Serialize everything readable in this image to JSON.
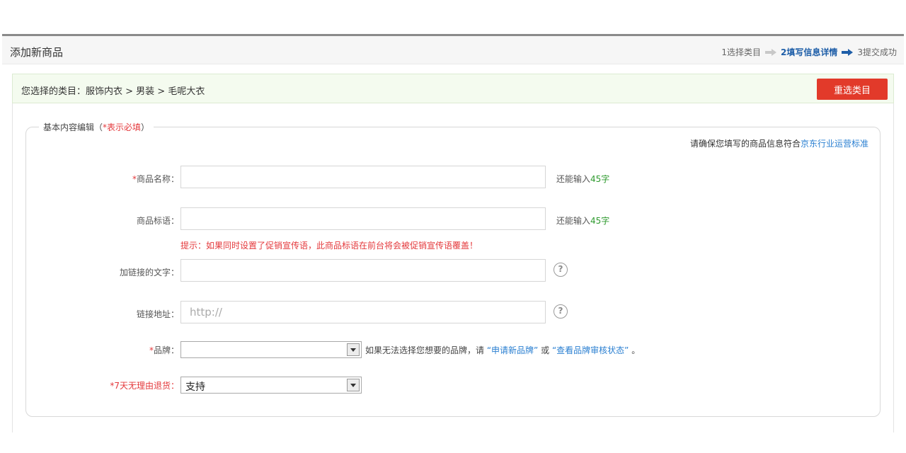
{
  "header": {
    "title": "添加新商品",
    "steps": [
      "1选择类目",
      "2填写信息详情",
      "3提交成功"
    ]
  },
  "category": {
    "label": "您选择的类目：",
    "path": "服饰内衣 > 男装 > 毛呢大衣",
    "reselect_button": "重选类目"
  },
  "section": {
    "legend_prefix": "基本内容编辑（",
    "legend_required": "*表示必填",
    "legend_suffix": "）",
    "notice_text": "请确保您填写的商品信息符合",
    "notice_link": "京东行业运营标准"
  },
  "form": {
    "product_name": {
      "star": "*",
      "label": "商品名称：",
      "value": "",
      "counter_prefix": "还能输入",
      "counter_num": "45字"
    },
    "product_slogan": {
      "label": "商品标语：",
      "value": "",
      "counter_prefix": "还能输入",
      "counter_num": "45字"
    },
    "slogan_hint": "提示：如果同时设置了促销宣传语，此商品标语在前台将会被促销宣传语覆盖！",
    "link_text": {
      "label": "加链接的文字：",
      "value": ""
    },
    "link_url": {
      "label": "链接地址：",
      "placeholder": "http://"
    },
    "brand": {
      "star": "*",
      "label": "品牌：",
      "value": "",
      "note_prefix": "如果无法选择您想要的品牌，请",
      "apply_link": "“申请新品牌”",
      "or": "或",
      "status_link": "“查看品牌审核状态”",
      "note_suffix": "。"
    },
    "return_policy": {
      "label": "*7天无理由退货：",
      "value": "支持"
    }
  }
}
